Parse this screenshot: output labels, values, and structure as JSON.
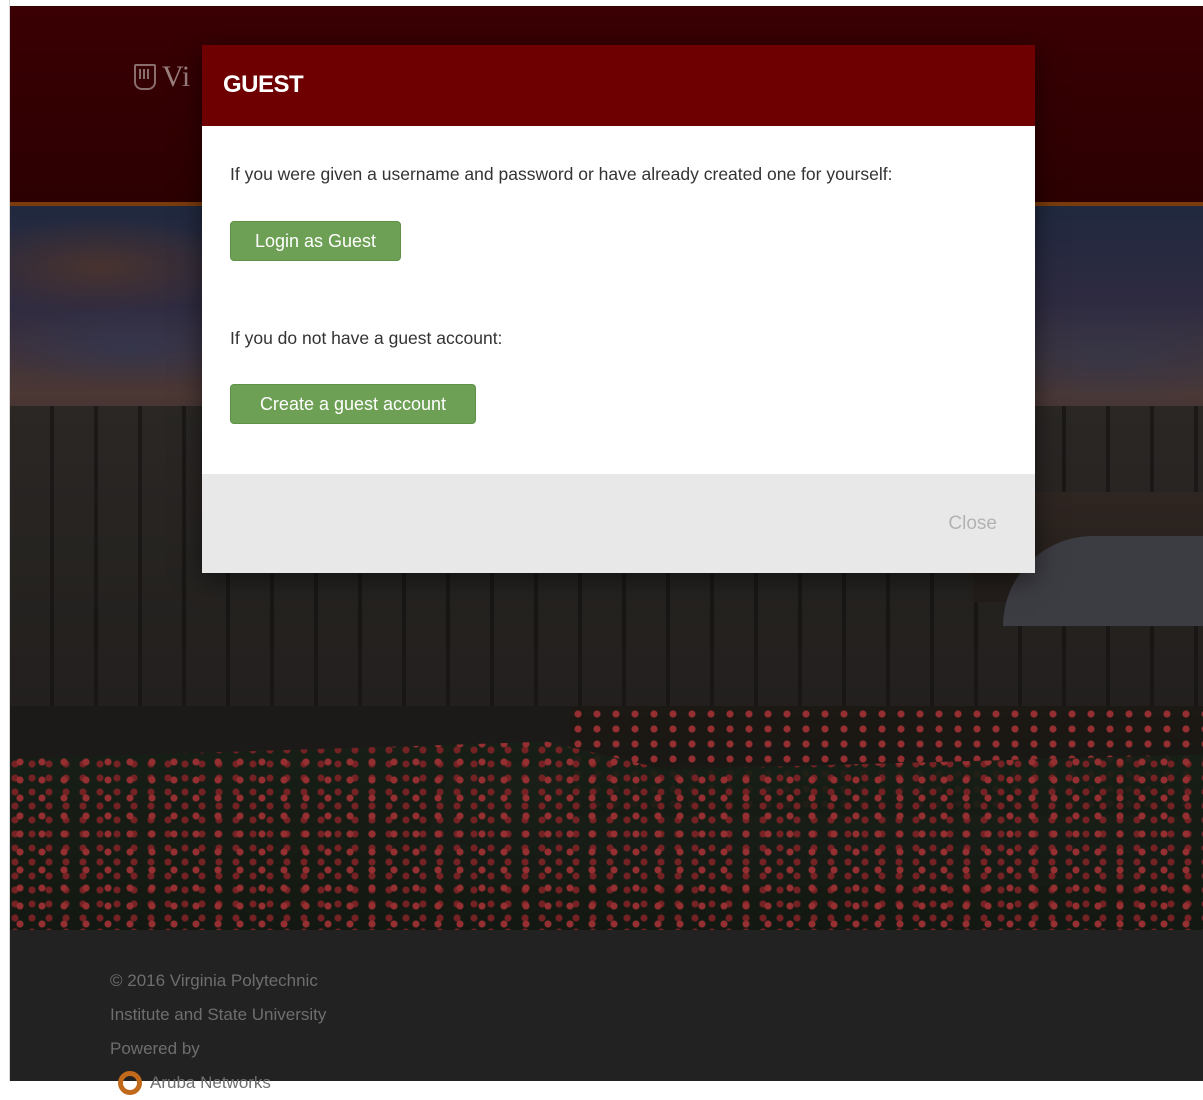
{
  "header": {
    "logo_text": "Vi"
  },
  "modal": {
    "title": "GUEST",
    "prompt_existing": "If you were given a username and password or have already created one for yourself:",
    "login_button": "Login as Guest",
    "prompt_new": "If you do not have a guest account:",
    "create_button": "Create a guest account",
    "close_button": "Close"
  },
  "footer": {
    "copyright_line1": "© 2016 Virginia Polytechnic",
    "copyright_line2": "Institute and State University",
    "powered_by": "Powered by",
    "vendor": "Aruba Networks"
  },
  "colors": {
    "header_maroon": "#6e0002",
    "button_green": "#6da054",
    "footer_bg": "#222222"
  }
}
